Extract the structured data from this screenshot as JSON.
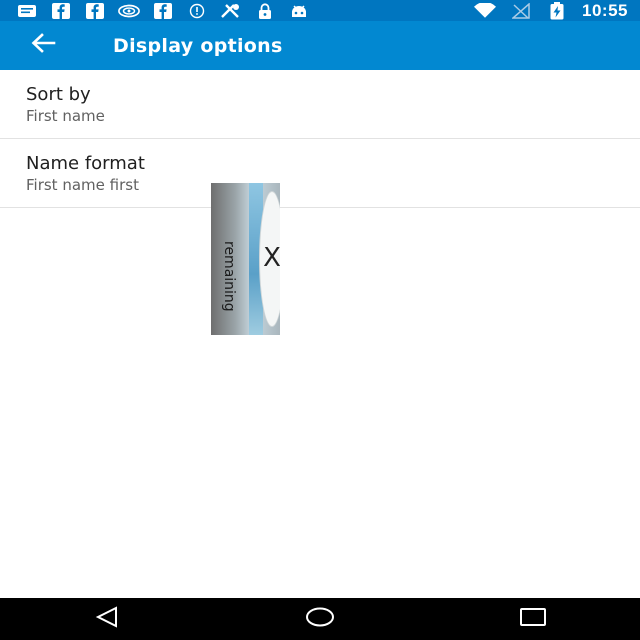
{
  "status_bar": {
    "time": "10:55",
    "icons": [
      "message-icon",
      "facebook-icon",
      "facebook-icon",
      "nvidia-icon",
      "facebook-icon",
      "info-icon",
      "no-signal-icon",
      "lock-icon",
      "android-icon",
      "wifi-icon",
      "cell-signal-icon",
      "battery-charging-icon"
    ]
  },
  "app_bar": {
    "title": "Display options"
  },
  "preferences": [
    {
      "title": "Sort by",
      "summary": "First name"
    },
    {
      "title": "Name format",
      "summary": "First name first"
    }
  ],
  "ad": {
    "text": "remaining",
    "close_glyph": "X"
  },
  "colors": {
    "status_bar": "#0076c0",
    "app_bar": "#0288d1",
    "nav_bar": "#000000"
  }
}
